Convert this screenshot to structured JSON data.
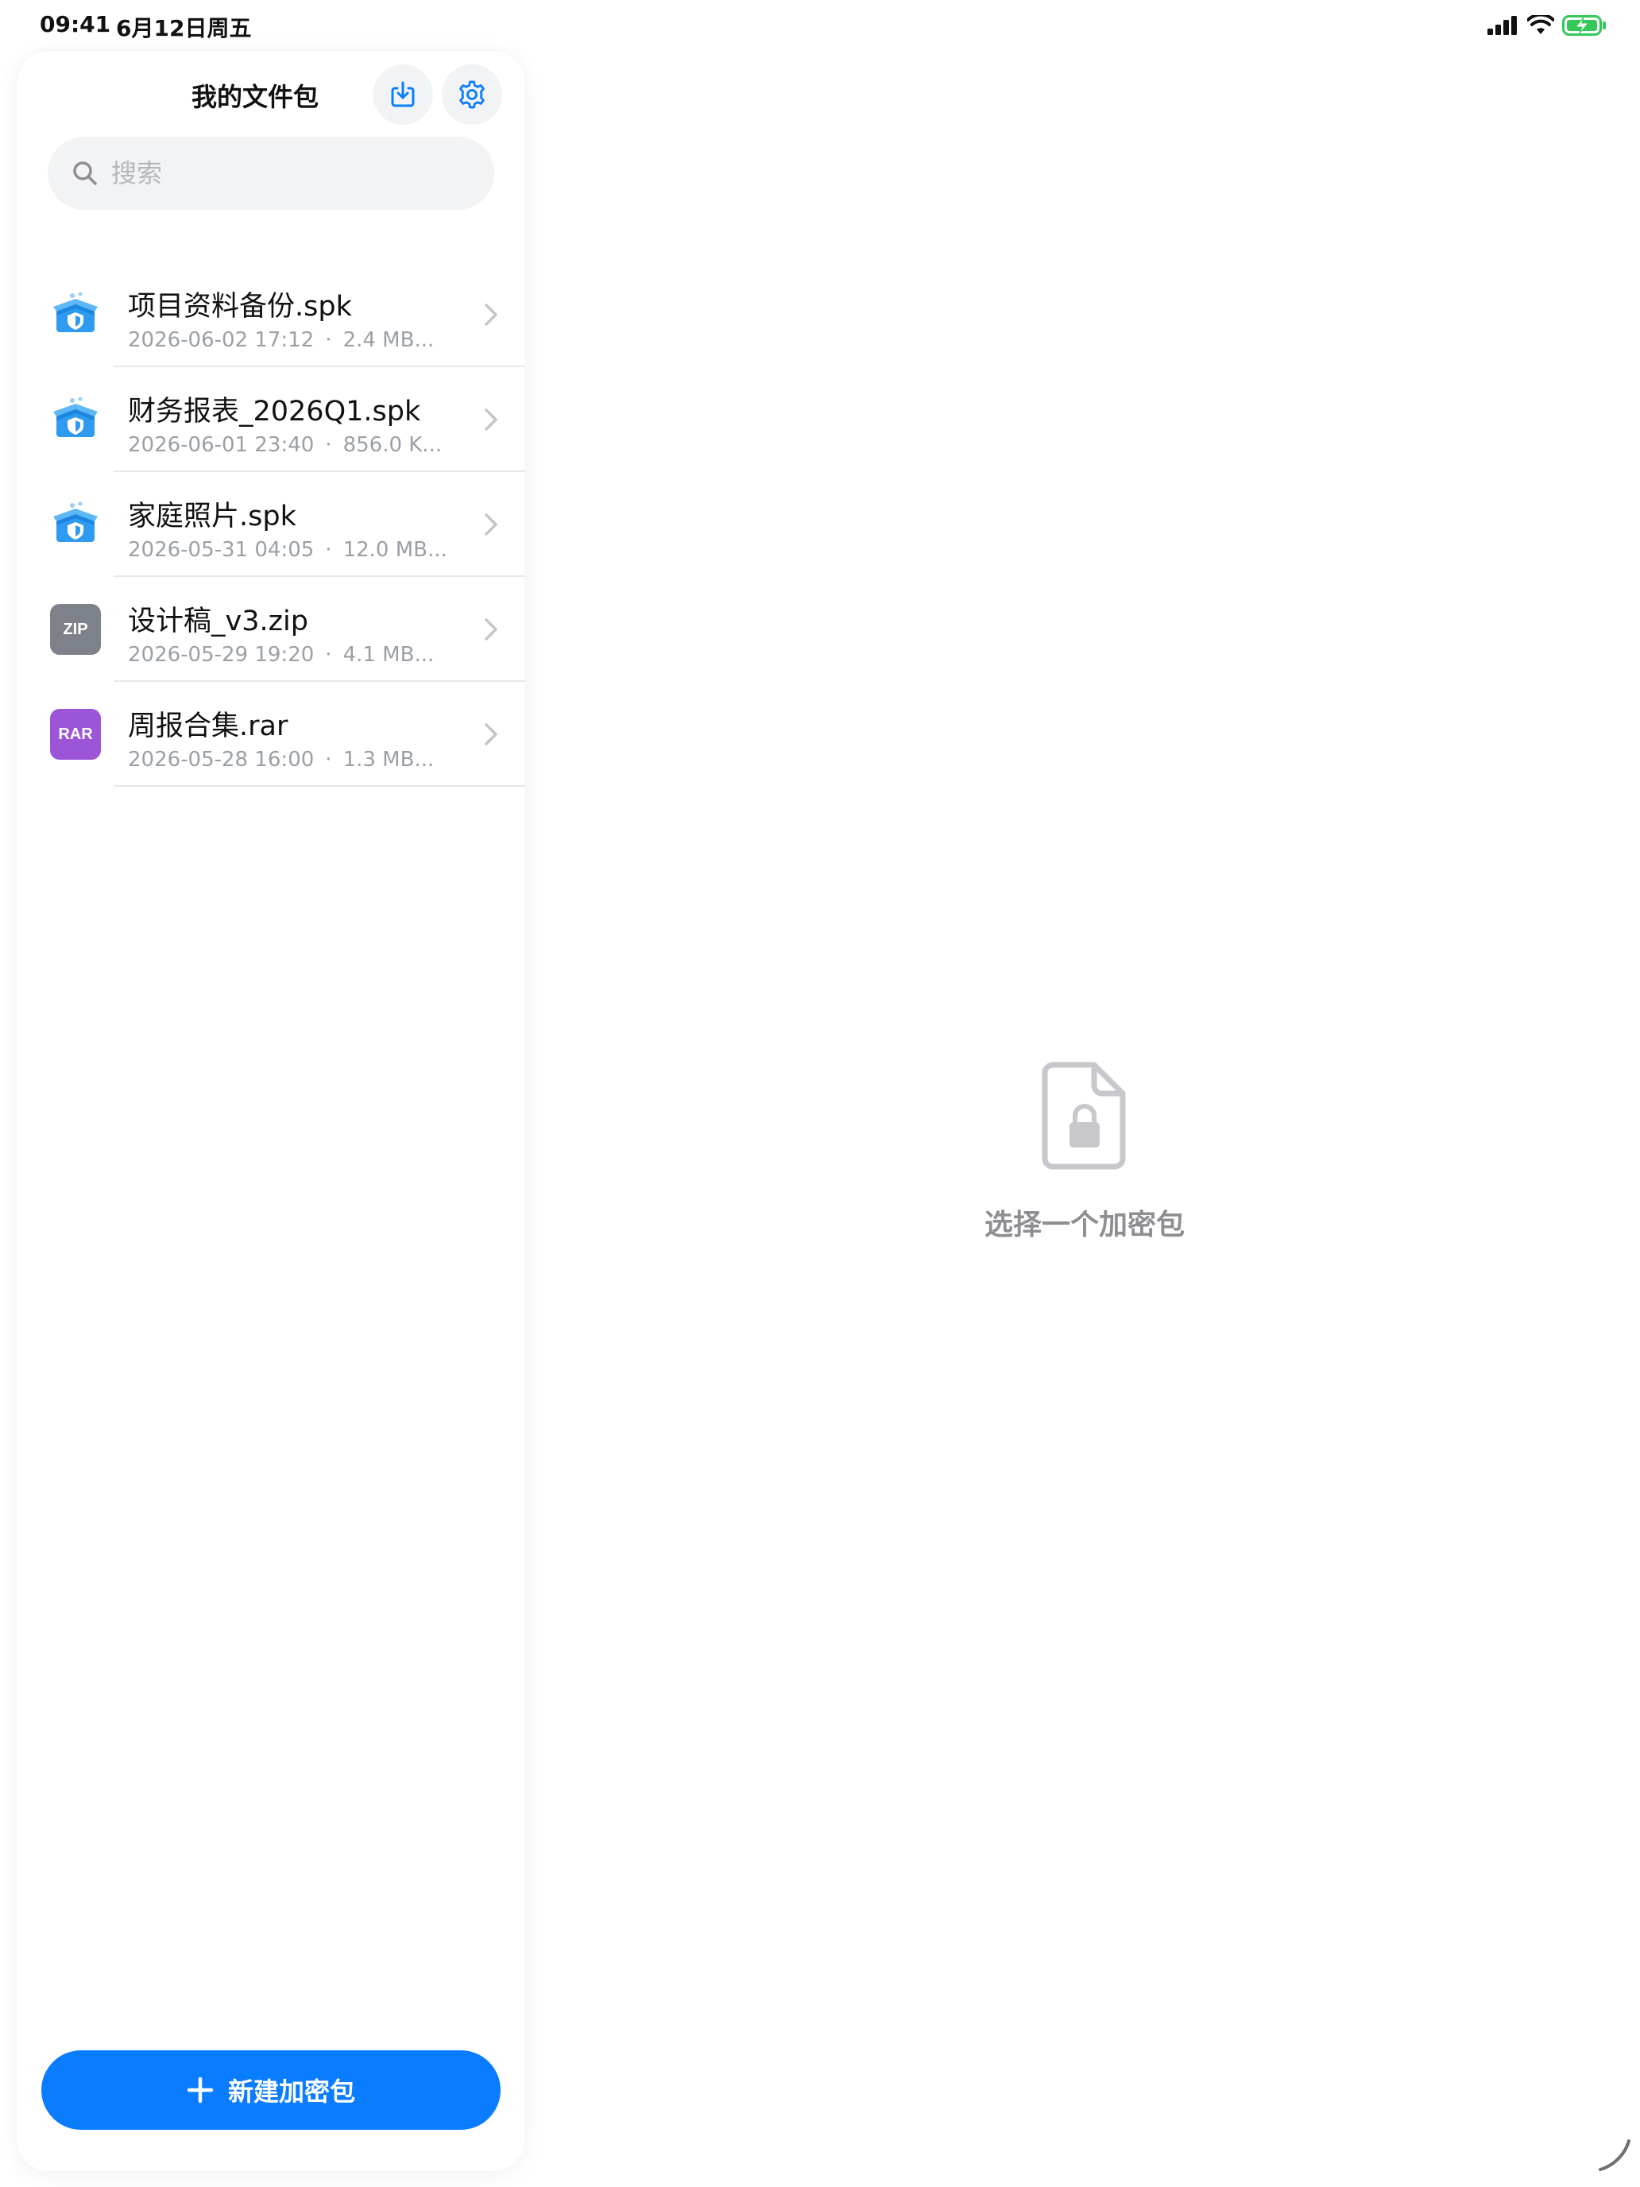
{
  "status_bar": {
    "time": "09:41",
    "date": "6月12日周五"
  },
  "sidebar": {
    "title": "我的文件包",
    "search_placeholder": "搜索",
    "files": [
      {
        "name": "项目资料备份.spk",
        "date": "2026-06-02 17:12",
        "size": "2.4 MB...",
        "type": "spk"
      },
      {
        "name": "财务报表_2026Q1.spk",
        "date": "2026-06-01 23:40",
        "size": "856.0 K...",
        "type": "spk"
      },
      {
        "name": "家庭照片.spk",
        "date": "2026-05-31 04:05",
        "size": "12.0 MB...",
        "type": "spk"
      },
      {
        "name": "设计稿_v3.zip",
        "date": "2026-05-29 19:20",
        "size": "4.1 MB...",
        "type": "zip",
        "badge": "ZIP"
      },
      {
        "name": "周报合集.rar",
        "date": "2026-05-28 16:00",
        "size": "1.3 MB...",
        "type": "rar",
        "badge": "RAR"
      }
    ],
    "new_button_label": "新建加密包"
  },
  "detail": {
    "empty_text": "选择一个加密包"
  },
  "colors": {
    "accent": "#0A7CFF",
    "zip_badge": "#7D8189",
    "rar_badge": "#9B55D6",
    "spk_icon": "#2E9BF0",
    "battery": "#34C759"
  }
}
